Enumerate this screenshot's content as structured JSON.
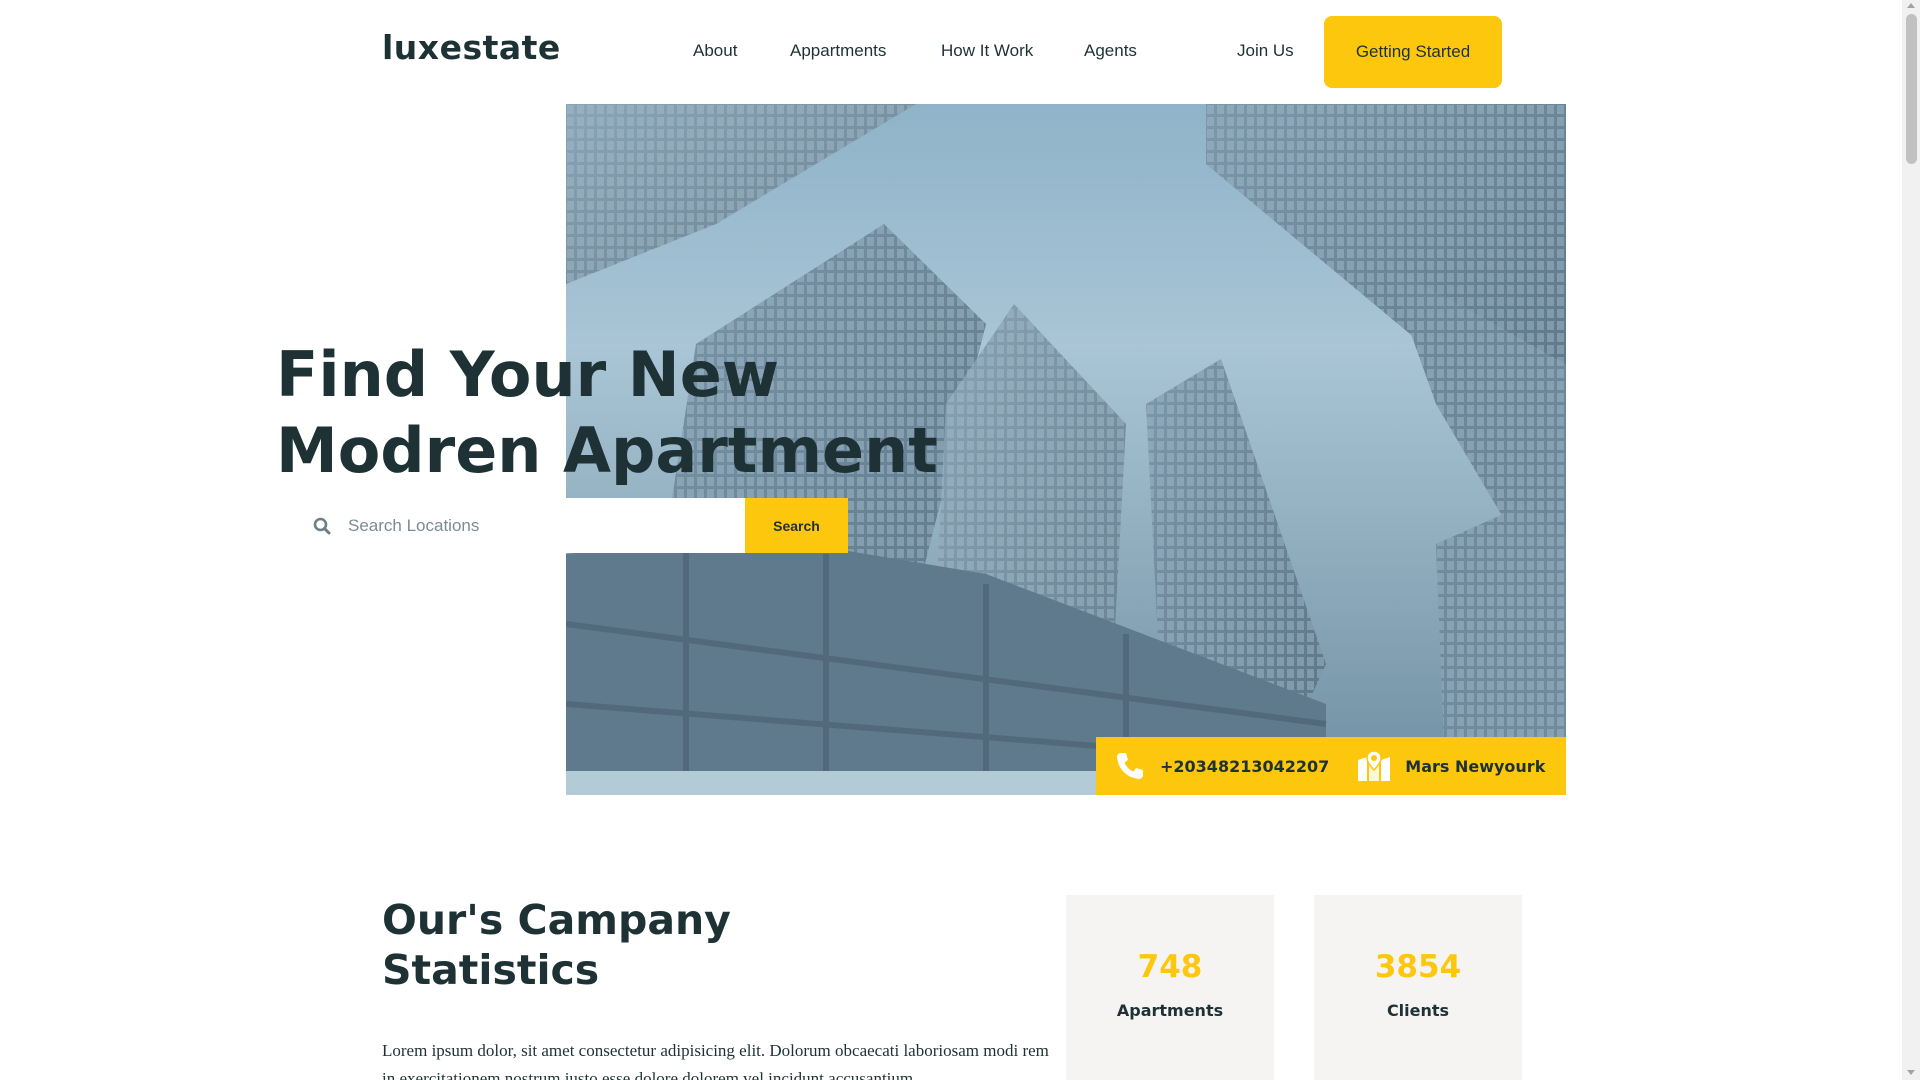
{
  "header": {
    "logo": "luxestate",
    "nav": {
      "about": "About",
      "apartments": "Appartments",
      "how_it_work": "How It Work",
      "agents": "Agents",
      "join_us": "Join Us"
    },
    "cta_label": "Getting Started"
  },
  "hero": {
    "title_line1": "Find Your New",
    "title_line2": "Modren Apartment",
    "search": {
      "placeholder": "Search Locations",
      "value": "",
      "button_label": "Search"
    },
    "contact": {
      "phone": "+20348213042207",
      "location": "Mars Newyourk"
    }
  },
  "stats": {
    "title_line1": "Our's Campany",
    "title_line2": "Statistics",
    "description": "Lorem ipsum dolor, sit amet consectetur adipisicing elit. Dolorum obcaecati laboriosam modi rem in exercitationem nostrum iusto esse dolore dolorem vel incidunt accusantium",
    "cards": [
      {
        "value": "748",
        "label": "Apartments"
      },
      {
        "value": "3854",
        "label": "Clients"
      }
    ]
  },
  "colors": {
    "accent": "#fcc70c",
    "text": "#1e3236",
    "card_bg": "#f5f4f2"
  }
}
